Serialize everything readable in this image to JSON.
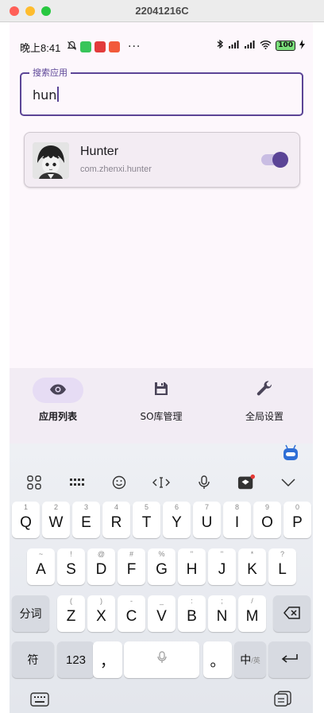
{
  "window": {
    "title": "22041216C"
  },
  "status_bar": {
    "time": "晚上8:41",
    "more": "···",
    "battery": "100"
  },
  "search": {
    "label": "搜索应用",
    "value": "hun"
  },
  "app_list": [
    {
      "name": "Hunter",
      "package": "com.zhenxi.hunter",
      "enabled": true
    }
  ],
  "bottom_nav": {
    "items": [
      {
        "label": "应用列表",
        "icon": "eye-icon",
        "active": true
      },
      {
        "label": "SO库管理",
        "icon": "save-icon",
        "active": false
      },
      {
        "label": "全局设置",
        "icon": "wrench-icon",
        "active": false
      }
    ]
  },
  "keyboard": {
    "row1": [
      {
        "key": "Q",
        "hint": "1"
      },
      {
        "key": "W",
        "hint": "2"
      },
      {
        "key": "E",
        "hint": "3"
      },
      {
        "key": "R",
        "hint": "4"
      },
      {
        "key": "T",
        "hint": "5"
      },
      {
        "key": "Y",
        "hint": "6"
      },
      {
        "key": "U",
        "hint": "7"
      },
      {
        "key": "I",
        "hint": "8"
      },
      {
        "key": "O",
        "hint": "9"
      },
      {
        "key": "P",
        "hint": "0"
      }
    ],
    "row2": [
      {
        "key": "A",
        "hint": "~"
      },
      {
        "key": "S",
        "hint": "!"
      },
      {
        "key": "D",
        "hint": "@"
      },
      {
        "key": "F",
        "hint": "#"
      },
      {
        "key": "G",
        "hint": "%"
      },
      {
        "key": "H",
        "hint": "\""
      },
      {
        "key": "J",
        "hint": "\""
      },
      {
        "key": "K",
        "hint": "*"
      },
      {
        "key": "L",
        "hint": "?"
      }
    ],
    "row3": [
      {
        "key": "Z",
        "hint": "("
      },
      {
        "key": "X",
        "hint": ")"
      },
      {
        "key": "C",
        "hint": "-"
      },
      {
        "key": "V",
        "hint": "_"
      },
      {
        "key": "B",
        "hint": ":"
      },
      {
        "key": "N",
        "hint": ";"
      },
      {
        "key": "M",
        "hint": "/"
      }
    ],
    "segment_key": "分词",
    "symbol_key": "符",
    "number_key": "123",
    "comma_key": "，",
    "period_key": "。",
    "lang_key_main": "中",
    "lang_key_sub": "/英"
  },
  "colors": {
    "accent": "#5b4496",
    "screen_bg": "#fdf7fc",
    "card_bg": "#f3ecf3",
    "nav_bg": "#f2ecf4",
    "nav_active_pill": "#e6dcf4"
  }
}
